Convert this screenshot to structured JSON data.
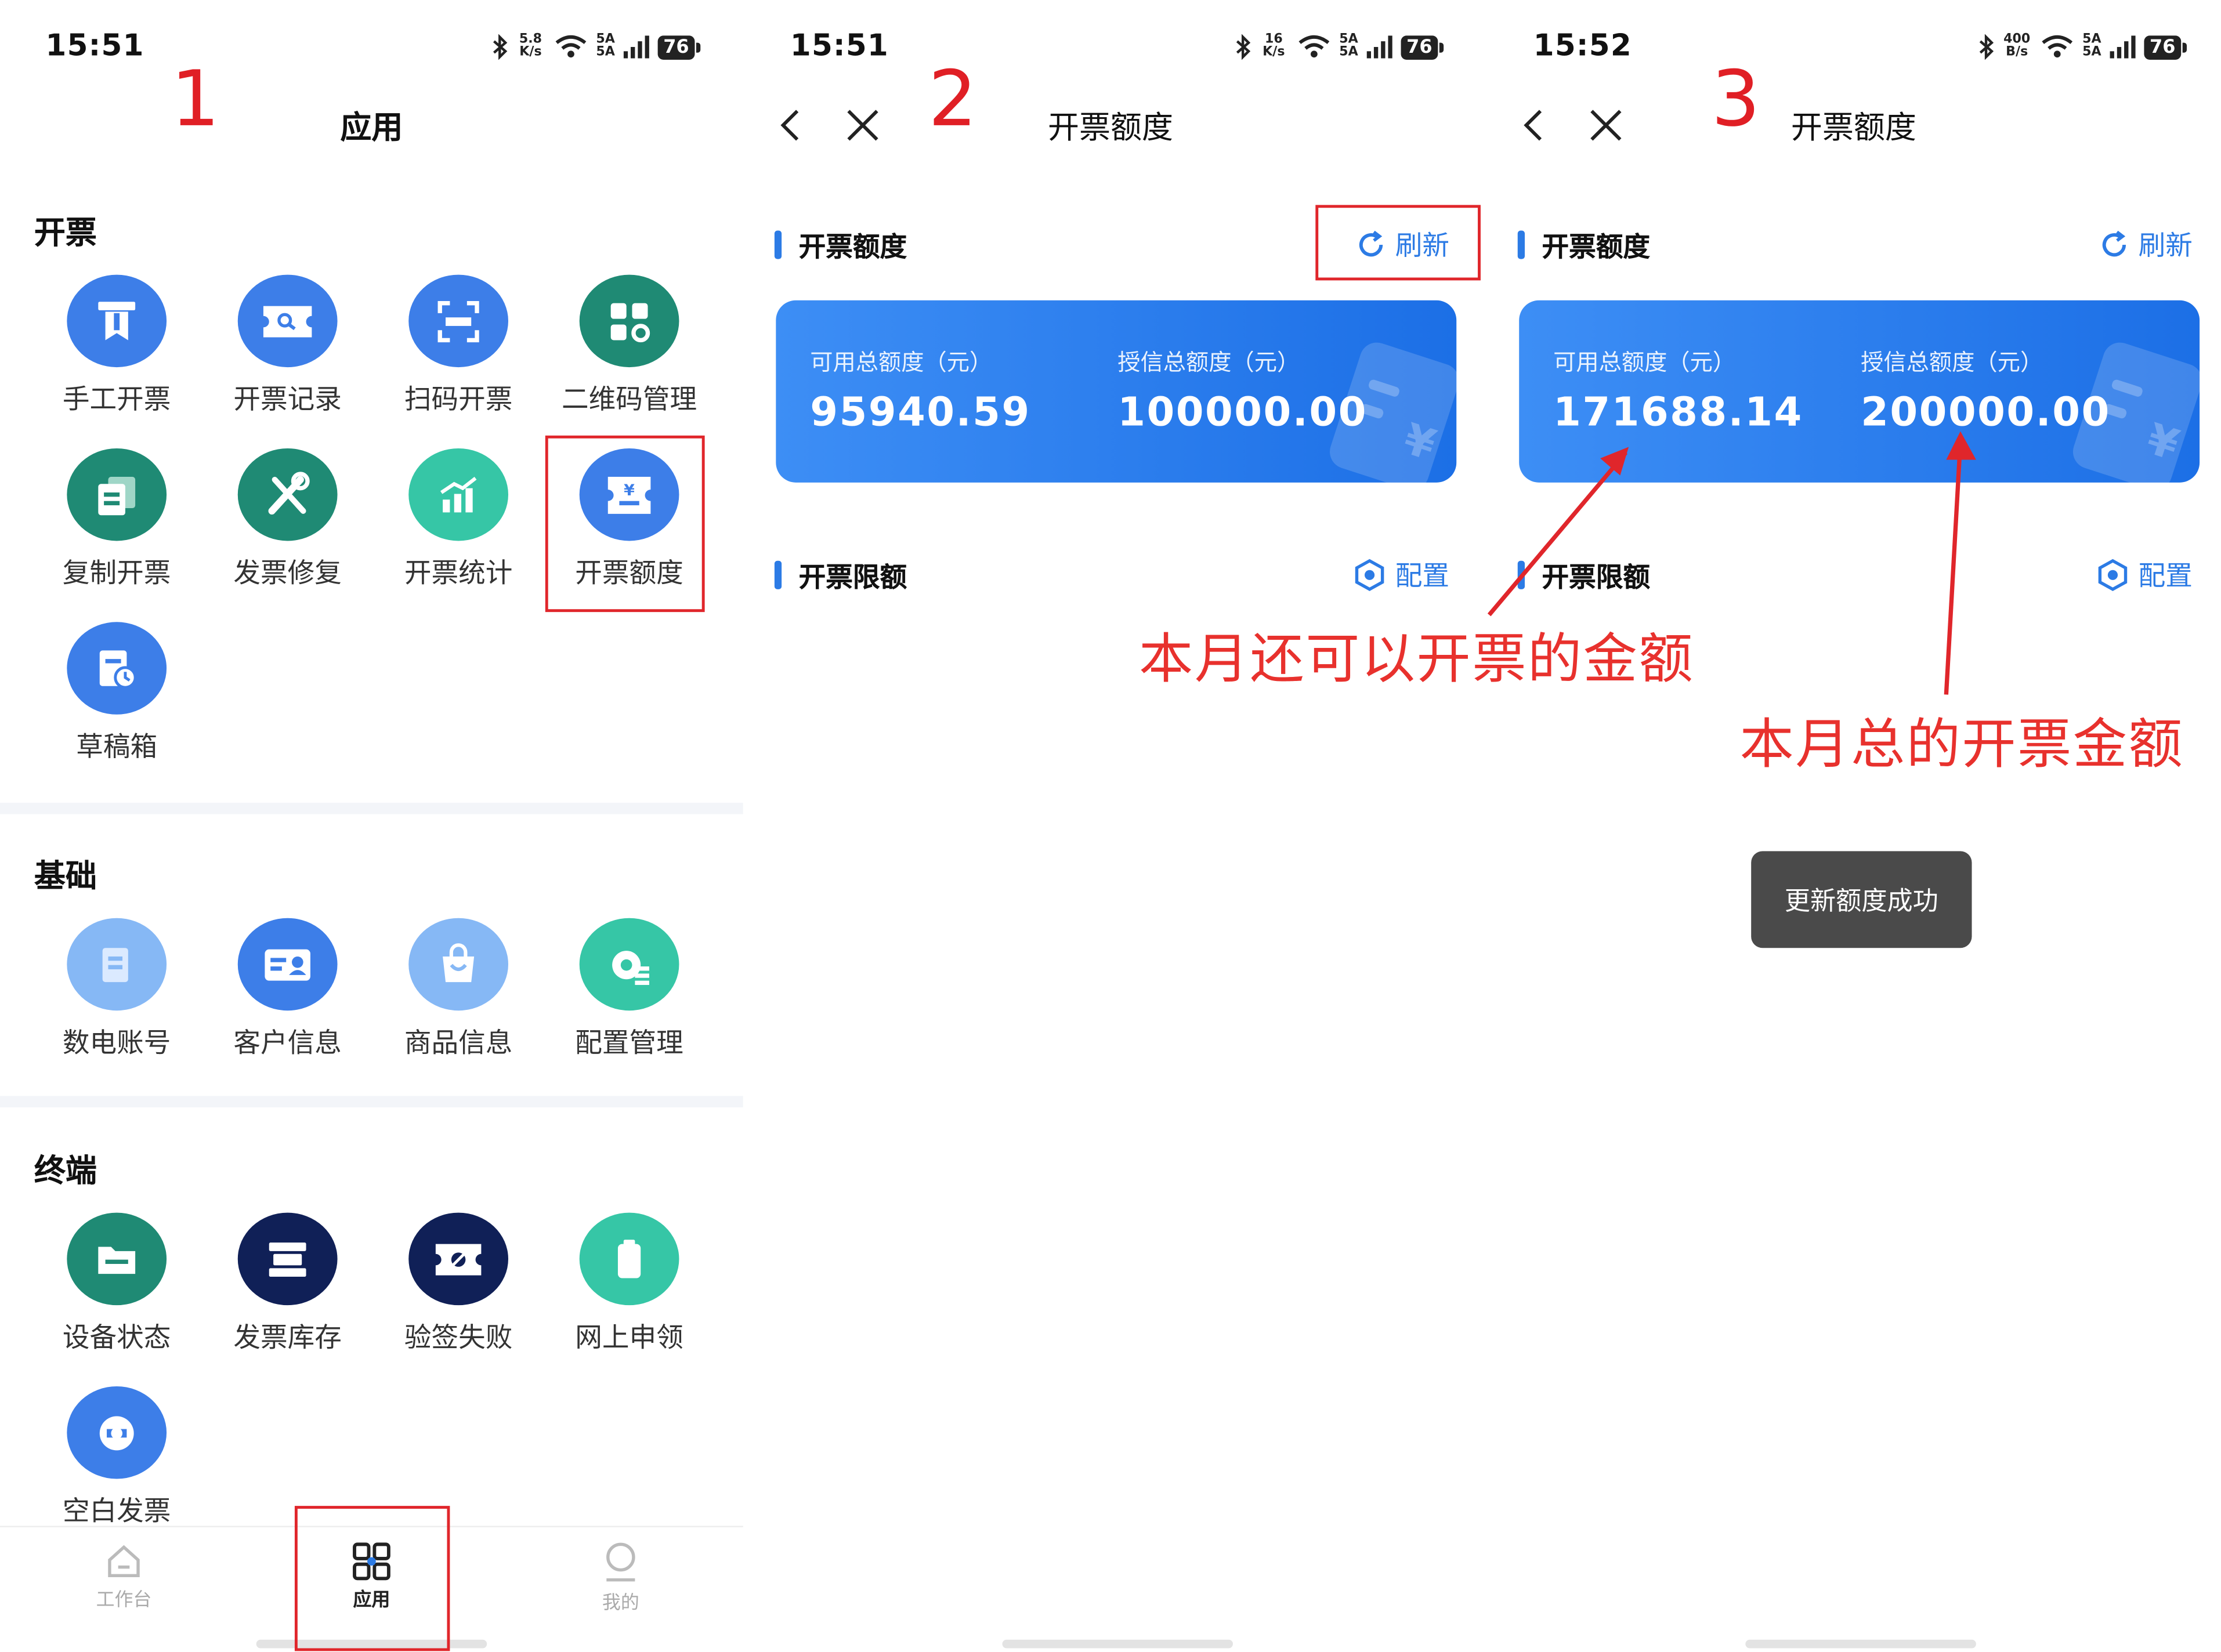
{
  "status": {
    "p1": {
      "time": "15:51",
      "speed_top": "5.8",
      "speed_bottom": "K/s",
      "signal": "5A\n5A",
      "battery": "76"
    },
    "p2": {
      "time": "15:51",
      "speed_top": "16",
      "speed_bottom": "K/s",
      "signal": "5A\n5A",
      "battery": "76"
    },
    "p3": {
      "time": "15:52",
      "speed_top": "400",
      "speed_bottom": "B/s",
      "signal": "5A\n5A",
      "battery": "76"
    }
  },
  "steps": [
    "1",
    "2",
    "3"
  ],
  "apps": {
    "title": "应用",
    "sections": [
      {
        "title": "开票",
        "items": [
          "手工开票",
          "开票记录",
          "扫码开票",
          "二维码管理",
          "复制开票",
          "发票修复",
          "开票统计",
          "开票额度",
          "草稿箱"
        ]
      },
      {
        "title": "基础",
        "items": [
          "数电账号",
          "客户信息",
          "商品信息",
          "配置管理"
        ]
      },
      {
        "title": "终端",
        "items": [
          "设备状态",
          "发票库存",
          "验签失败",
          "网上申领",
          "空白发票"
        ]
      }
    ],
    "tabs": [
      "工作台",
      "应用",
      "我的"
    ]
  },
  "quota": {
    "title": "开票额度",
    "section_quota": "开票额度",
    "refresh": "刷新",
    "section_limit": "开票限额",
    "config": "配置",
    "available_label": "可用总额度（元）",
    "credit_label": "授信总额度（元）",
    "before": {
      "available": "95940.59",
      "credit": "100000.00"
    },
    "after": {
      "available": "171688.14",
      "credit": "200000.00"
    },
    "toast": "更新额度成功"
  },
  "annotations": {
    "available_note": "本月还可以开票的金额",
    "credit_note": "本月总的开票金额"
  },
  "colors": {
    "accent": "#2c7be5",
    "annotation_red": "#e0262b"
  }
}
